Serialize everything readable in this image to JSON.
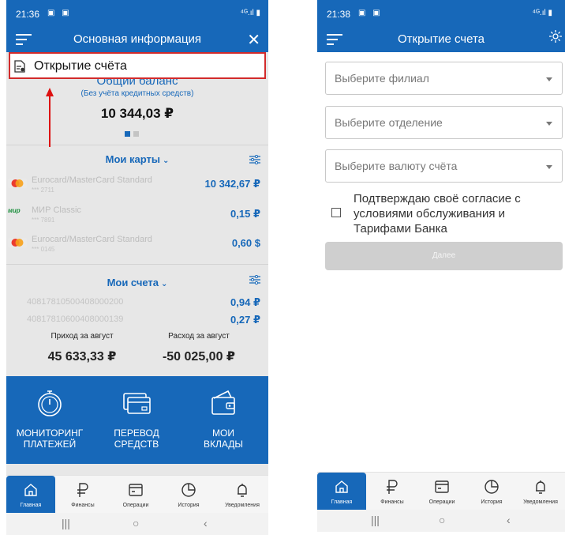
{
  "left": {
    "status": {
      "time": "21:36"
    },
    "header": {
      "title": "Основная информация",
      "close": "✕"
    },
    "menu_popup": {
      "label": "Открытие счёта"
    },
    "balance": {
      "title": "Общий баланс",
      "subtitle": "(Без учёта кредитных средств)",
      "value": "10 344,03 ₽"
    },
    "cards": {
      "title": "Мои карты",
      "items": [
        {
          "name": "Eurocard/MasterCard Standard",
          "number": "*** 2711",
          "value": "10 342,67 ₽",
          "logo": "mastercard"
        },
        {
          "name": "МИР Classic",
          "number": "*** 7891",
          "value": "0,15 ₽",
          "logo": "mir",
          "logo_text": "мир"
        },
        {
          "name": "Eurocard/MasterCard Standard",
          "number": "*** 0145",
          "value": "0,60 $",
          "logo": "mastercard"
        }
      ]
    },
    "accounts": {
      "title": "Мои счета",
      "items": [
        {
          "number": "40817810500408000200",
          "value": "0,94 ₽"
        },
        {
          "number": "40817810600408000139",
          "value": "0,27 ₽"
        }
      ]
    },
    "flows": {
      "income_label": "Приход за август",
      "income_value": "45 633,33 ₽",
      "expense_label": "Расход за август",
      "expense_value": "-50 025,00 ₽"
    },
    "tiles": [
      {
        "line1": "МОНИТОРИНГ",
        "line2": "ПЛАТЕЖЕЙ",
        "icon": "stopwatch-icon"
      },
      {
        "line1": "ПЕРЕВОД",
        "line2": "СРЕДСТВ",
        "icon": "card-icon"
      },
      {
        "line1": "МОИ",
        "line2": "ВКЛАДЫ",
        "icon": "wallet-icon"
      }
    ]
  },
  "right": {
    "status": {
      "time": "21:38"
    },
    "header": {
      "title": "Открытие счета"
    },
    "form": {
      "branch_placeholder": "Выберите филиал",
      "office_placeholder": "Выберите отделение",
      "currency_placeholder": "Выберите валюту счёта",
      "consent_text": "Подтверждаю своё согласие с условиями обслуживания и Тарифами Банка",
      "next_label": "Далее"
    }
  },
  "nav": {
    "items": [
      {
        "label": "Главная",
        "icon": "home-icon"
      },
      {
        "label": "Финансы",
        "icon": "ruble-icon"
      },
      {
        "label": "Операции",
        "icon": "operations-icon"
      },
      {
        "label": "История",
        "icon": "history-icon"
      },
      {
        "label": "Уведомления",
        "icon": "bell-icon"
      }
    ]
  },
  "colors": {
    "brand": "#1768b9",
    "highlight": "#d22b2b",
    "disabled": "#cfcfcf"
  }
}
